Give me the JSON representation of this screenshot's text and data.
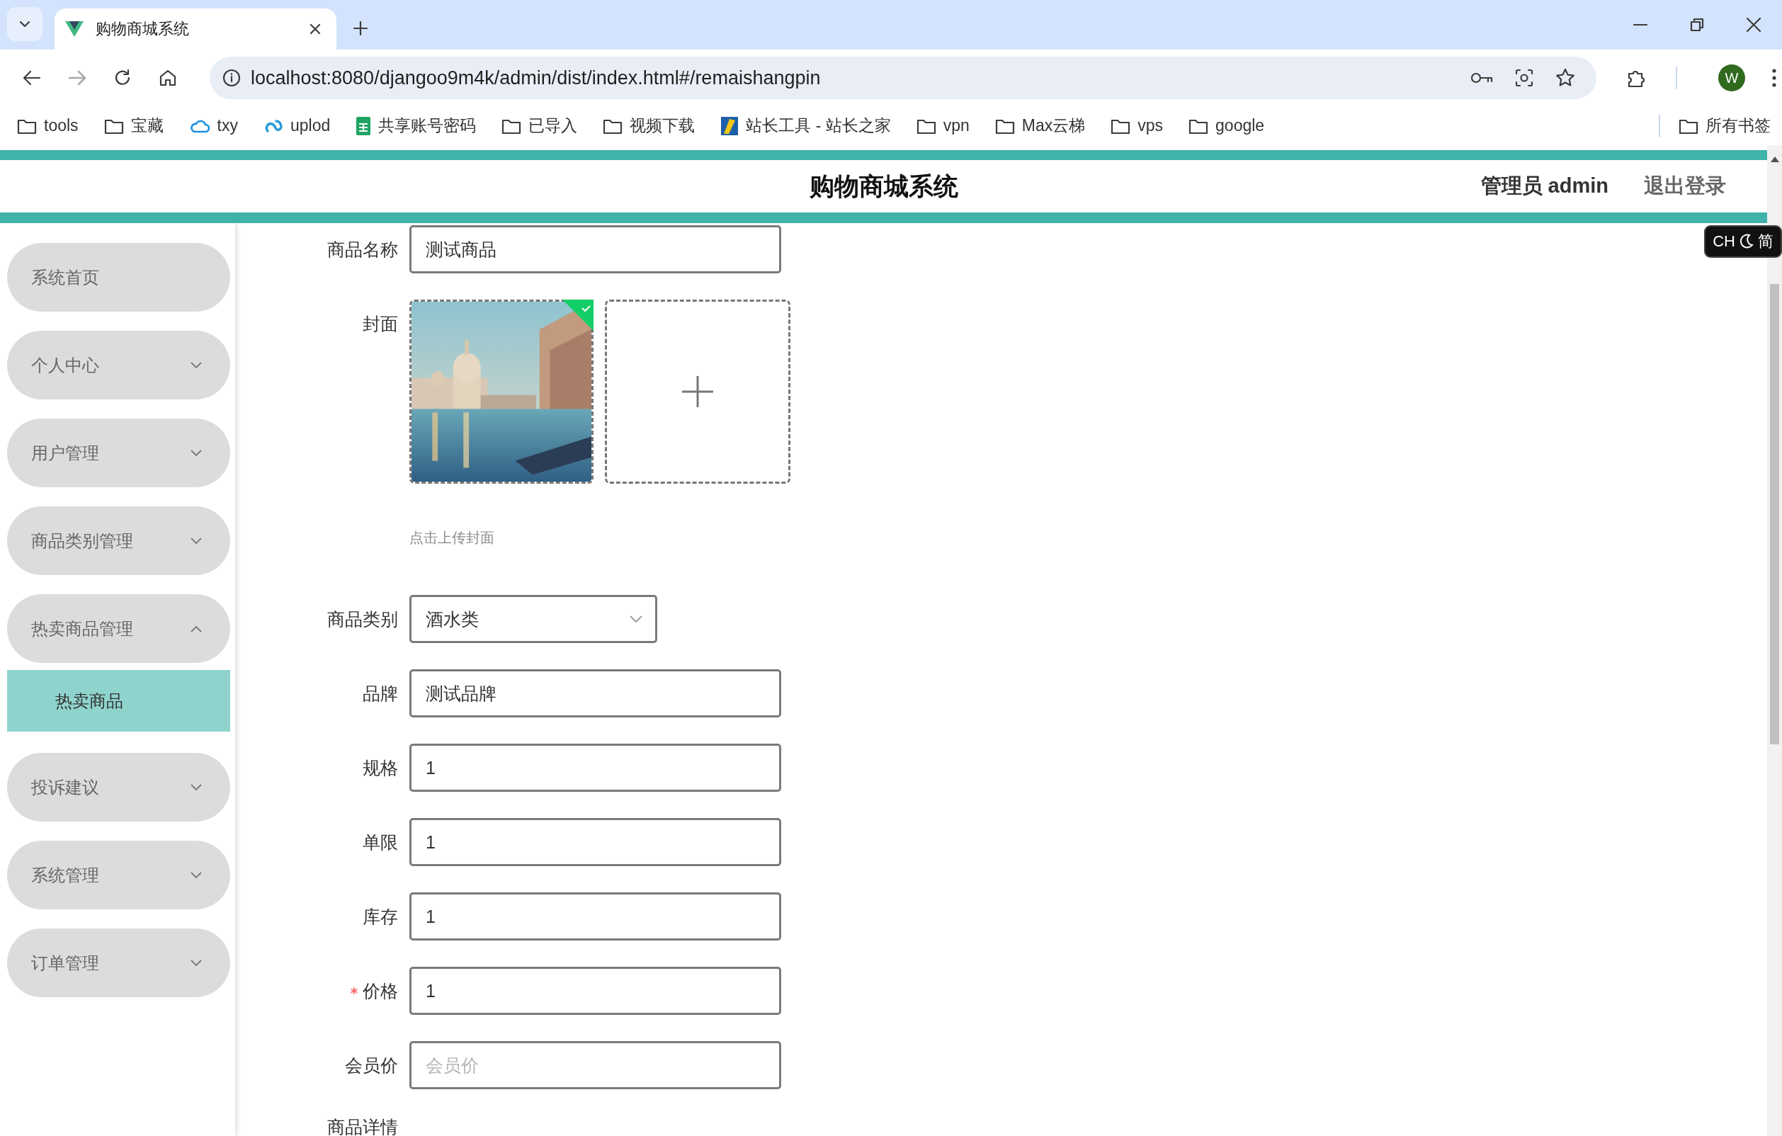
{
  "browser": {
    "tabs": [
      {
        "title": "购物商城系统",
        "selected": true
      }
    ],
    "address": "localhost:8080/djangoo9m4k/admin/dist/index.html#/remaishangpin",
    "profile": "W",
    "bookmarks": [
      {
        "label": "tools",
        "kind": "folder"
      },
      {
        "label": "宝藏",
        "kind": "folder"
      },
      {
        "label": "txy",
        "kind": "cloud"
      },
      {
        "label": "uplod",
        "kind": "swirl"
      },
      {
        "label": "共享账号密码",
        "kind": "sheet"
      },
      {
        "label": "已导入",
        "kind": "folder"
      },
      {
        "label": "视频下载",
        "kind": "folder"
      },
      {
        "label": "站长工具 - 站长之家",
        "kind": "site"
      },
      {
        "label": "vpn",
        "kind": "folder"
      },
      {
        "label": "Max云梯",
        "kind": "folder"
      },
      {
        "label": "vps",
        "kind": "folder"
      },
      {
        "label": "google",
        "kind": "folder"
      }
    ],
    "all_bookmarks": "所有书签"
  },
  "ime": {
    "mode": "CH",
    "script": "简"
  },
  "header": {
    "title": "购物商城系统",
    "user": "管理员 admin",
    "logout": "退出登录"
  },
  "sidebar": {
    "items": [
      {
        "label": "系统首页",
        "kind": "link"
      },
      {
        "label": "个人中心",
        "kind": "menu",
        "expanded": false
      },
      {
        "label": "用户管理",
        "kind": "menu",
        "expanded": false
      },
      {
        "label": "商品类别管理",
        "kind": "menu",
        "expanded": false
      },
      {
        "label": "热卖商品管理",
        "kind": "menu",
        "expanded": true,
        "children": [
          {
            "label": "热卖商品",
            "selected": true
          }
        ]
      },
      {
        "label": "投诉建议",
        "kind": "menu",
        "expanded": false
      },
      {
        "label": "系统管理",
        "kind": "menu",
        "expanded": false
      },
      {
        "label": "订单管理",
        "kind": "menu",
        "expanded": false
      }
    ]
  },
  "form": {
    "fields": [
      {
        "label": "商品名称",
        "kind": "text",
        "value": "测试商品",
        "required": false
      },
      {
        "label": "封面",
        "kind": "upload",
        "hint": "点击上传封面",
        "required": false
      },
      {
        "label": "商品类别",
        "kind": "select",
        "value": "酒水类",
        "required": false
      },
      {
        "label": "品牌",
        "kind": "text",
        "value": "测试品牌",
        "required": false
      },
      {
        "label": "规格",
        "kind": "text",
        "value": "1",
        "required": false
      },
      {
        "label": "单限",
        "kind": "text",
        "value": "1",
        "required": false
      },
      {
        "label": "库存",
        "kind": "text",
        "value": "1",
        "required": false
      },
      {
        "label": "价格",
        "kind": "text",
        "value": "1",
        "required": true
      },
      {
        "label": "会员价",
        "kind": "text",
        "placeholder": "会员价",
        "required": false
      },
      {
        "label": "商品详情",
        "kind": "editor",
        "required": false
      }
    ]
  }
}
